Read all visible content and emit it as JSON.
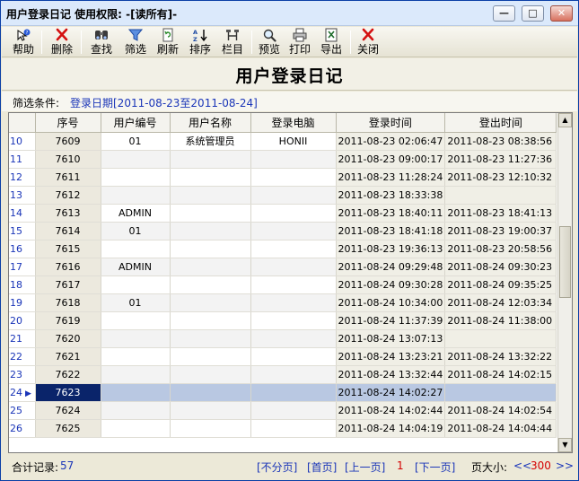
{
  "window": {
    "title": "用户登录日记  使用权限: -[读所有]-",
    "min_glyph": "—",
    "max_glyph": "□",
    "close_glyph": "✕"
  },
  "toolbar": {
    "items": [
      {
        "label": "帮助",
        "icon": "help-icon"
      },
      {
        "label": "删除",
        "icon": "delete-icon"
      },
      {
        "label": "查找",
        "icon": "find-icon"
      },
      {
        "label": "筛选",
        "icon": "filter-icon"
      },
      {
        "label": "刷新",
        "icon": "refresh-icon"
      },
      {
        "label": "排序",
        "icon": "sort-icon"
      },
      {
        "label": "栏目",
        "icon": "columns-icon"
      },
      {
        "label": "预览",
        "icon": "preview-icon"
      },
      {
        "label": "打印",
        "icon": "print-icon"
      },
      {
        "label": "导出",
        "icon": "export-icon"
      },
      {
        "label": "关闭",
        "icon": "close-icon"
      }
    ]
  },
  "page_title": "用户登录日记",
  "filter": {
    "label": "筛选条件:",
    "value": "登录日期[2011-08-23至2011-08-24]"
  },
  "table": {
    "columns": [
      "序号",
      "用户编号",
      "用户名称",
      "登录电脑",
      "登录时间",
      "登出时间"
    ],
    "rows": [
      {
        "n": "10",
        "id": "7609",
        "user_no": "01",
        "user_name": "系统管理员",
        "pc": "HONII",
        "login": "2011-08-23 02:06:47",
        "logout": "2011-08-23 08:38:56"
      },
      {
        "n": "11",
        "id": "7610",
        "user_no": "",
        "user_name": "",
        "pc": "",
        "login": "2011-08-23 09:00:17",
        "logout": "2011-08-23 11:27:36"
      },
      {
        "n": "12",
        "id": "7611",
        "user_no": "",
        "user_name": "",
        "pc": "",
        "login": "2011-08-23 11:28:24",
        "logout": "2011-08-23 12:10:32"
      },
      {
        "n": "13",
        "id": "7612",
        "user_no": "",
        "user_name": "",
        "pc": "",
        "login": "2011-08-23 18:33:38",
        "logout": ""
      },
      {
        "n": "14",
        "id": "7613",
        "user_no": "ADMIN",
        "user_name": "",
        "pc": "",
        "login": "2011-08-23 18:40:11",
        "logout": "2011-08-23 18:41:13"
      },
      {
        "n": "15",
        "id": "7614",
        "user_no": "01",
        "user_name": "",
        "pc": "",
        "login": "2011-08-23 18:41:18",
        "logout": "2011-08-23 19:00:37"
      },
      {
        "n": "16",
        "id": "7615",
        "user_no": "",
        "user_name": "",
        "pc": "",
        "login": "2011-08-23 19:36:13",
        "logout": "2011-08-23 20:58:56"
      },
      {
        "n": "17",
        "id": "7616",
        "user_no": "ADMIN",
        "user_name": "",
        "pc": "",
        "login": "2011-08-24 09:29:48",
        "logout": "2011-08-24 09:30:23"
      },
      {
        "n": "18",
        "id": "7617",
        "user_no": "",
        "user_name": "",
        "pc": "",
        "login": "2011-08-24 09:30:28",
        "logout": "2011-08-24 09:35:25"
      },
      {
        "n": "19",
        "id": "7618",
        "user_no": "01",
        "user_name": "",
        "pc": "",
        "login": "2011-08-24 10:34:00",
        "logout": "2011-08-24 12:03:34"
      },
      {
        "n": "20",
        "id": "7619",
        "user_no": "",
        "user_name": "",
        "pc": "",
        "login": "2011-08-24 11:37:39",
        "logout": "2011-08-24 11:38:00"
      },
      {
        "n": "21",
        "id": "7620",
        "user_no": "",
        "user_name": "",
        "pc": "",
        "login": "2011-08-24 13:07:13",
        "logout": ""
      },
      {
        "n": "22",
        "id": "7621",
        "user_no": "",
        "user_name": "",
        "pc": "",
        "login": "2011-08-24 13:23:21",
        "logout": "2011-08-24 13:32:22"
      },
      {
        "n": "23",
        "id": "7622",
        "user_no": "",
        "user_name": "",
        "pc": "",
        "login": "2011-08-24 13:32:44",
        "logout": "2011-08-24 14:02:15"
      },
      {
        "n": "24",
        "id": "7623",
        "user_no": "",
        "user_name": "",
        "pc": "",
        "login": "2011-08-24 14:02:27",
        "logout": ""
      },
      {
        "n": "25",
        "id": "7624",
        "user_no": "",
        "user_name": "",
        "pc": "",
        "login": "2011-08-24 14:02:44",
        "logout": "2011-08-24 14:02:54"
      },
      {
        "n": "26",
        "id": "7625",
        "user_no": "",
        "user_name": "",
        "pc": "",
        "login": "2011-08-24 14:04:19",
        "logout": "2011-08-24 14:04:44"
      }
    ],
    "selected_row": "24"
  },
  "status": {
    "total_label": "合计记录:",
    "total_value": "57",
    "no_paging": "[不分页]",
    "first_page": "[首页]",
    "prev_page": "[上一页]",
    "current_page": "1",
    "next_page": "[下一页]",
    "page_size_label": "页大小:",
    "page_size_dec": "<<",
    "page_size": "300",
    "page_size_inc": ">>"
  },
  "colors": {
    "link_blue": "#1a35b8",
    "page_number_red": "#d40000",
    "selection": "#b9c8e2",
    "window_border": "#0b3fa6"
  }
}
